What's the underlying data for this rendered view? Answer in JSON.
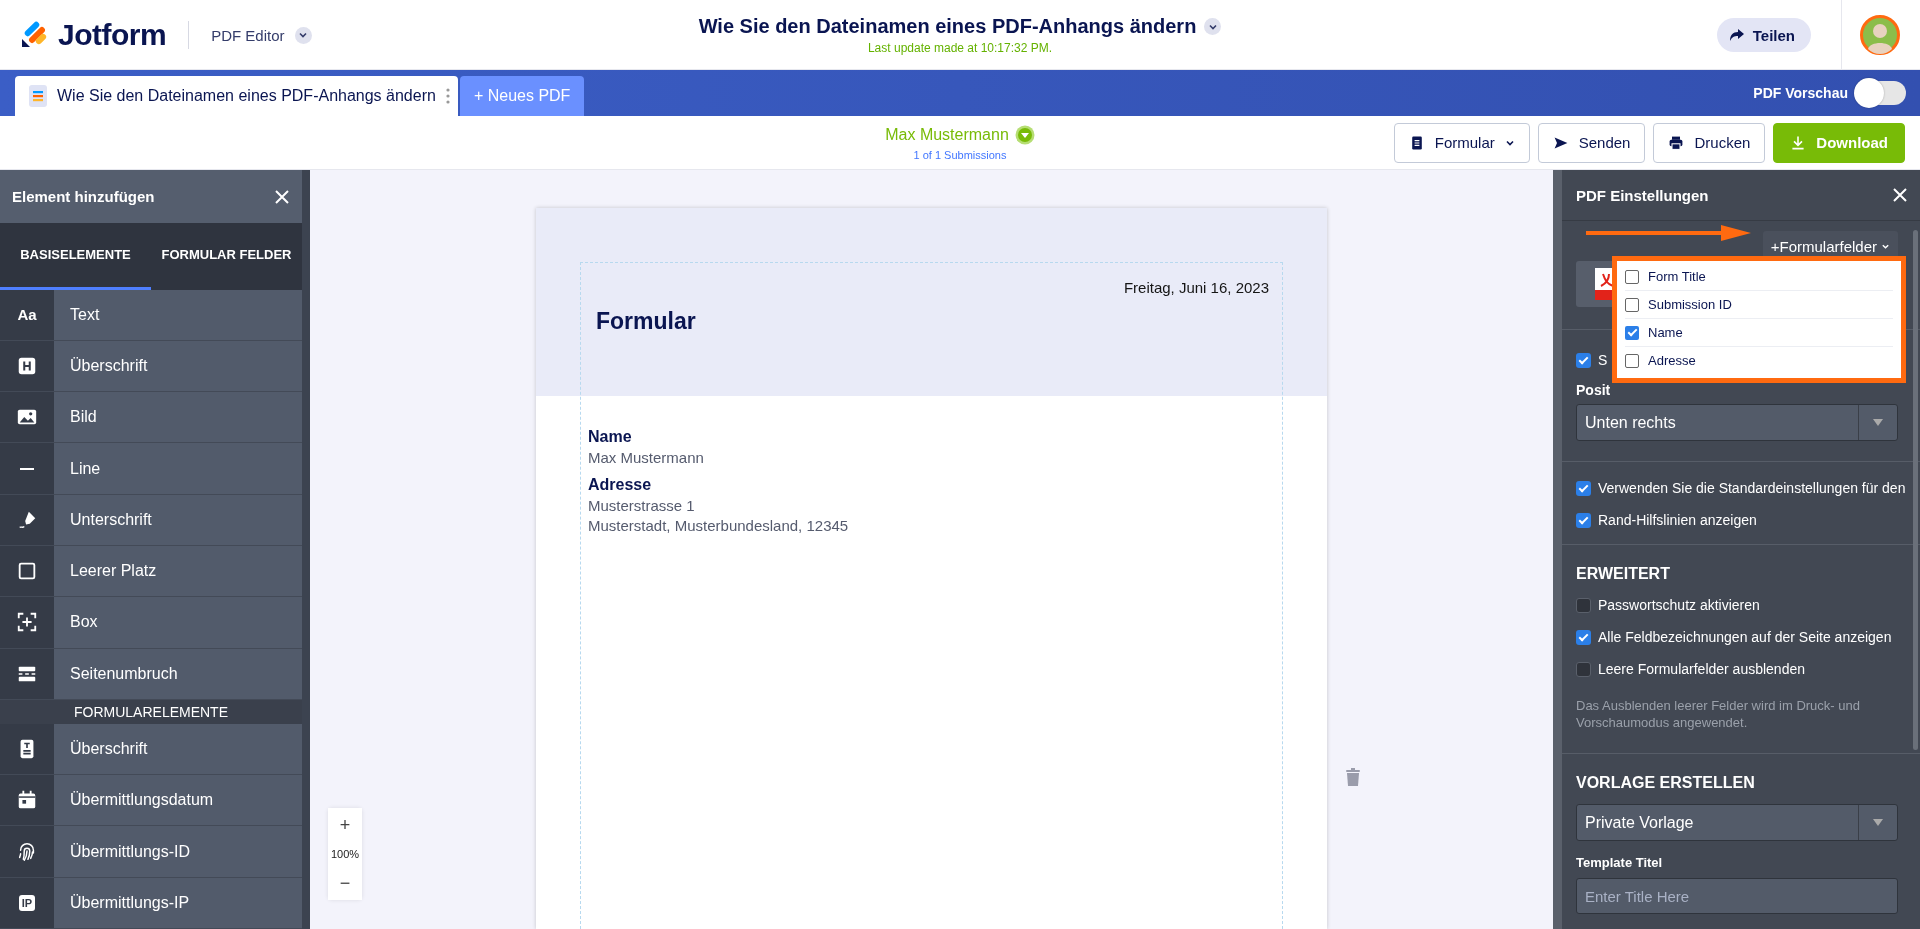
{
  "header": {
    "brand": "Jotform",
    "product": "PDF Editor",
    "title": "Wie Sie den Dateinamen eines PDF-Anhangs ändern",
    "last_update": "Last update made at 10:17:32 PM.",
    "share_button": "Teilen"
  },
  "tabs": [
    {
      "label": "Wie Sie den Dateinamen eines PDF-Anhangs ändern",
      "selected": true
    },
    {
      "label": "+ Neues PDF",
      "selected": false
    }
  ],
  "preview_toggle": {
    "label": "PDF Vorschau",
    "on": false
  },
  "submission": {
    "name": "Max Mustermann",
    "count": "1 of 1 Submissions"
  },
  "toolbar_buttons": [
    {
      "label": "Formular",
      "kind": "menu"
    },
    {
      "label": "Senden",
      "kind": "plain"
    },
    {
      "label": "Drucken",
      "kind": "plain"
    },
    {
      "label": "Download",
      "kind": "primary"
    }
  ],
  "left_panel": {
    "title": "Element hinzufügen",
    "tabs": [
      {
        "label": "BASISELEMENTE",
        "selected": true
      },
      {
        "label": "FORMULAR FELDER",
        "selected": false
      }
    ],
    "items": [
      {
        "kind": "item",
        "label": "Text",
        "icon_text": "Aa"
      },
      {
        "kind": "item",
        "label": "Überschrift"
      },
      {
        "kind": "item",
        "label": "Bild"
      },
      {
        "kind": "item",
        "label": "Line"
      },
      {
        "kind": "item",
        "label": "Unterschrift"
      },
      {
        "kind": "item",
        "label": "Leerer Platz"
      },
      {
        "kind": "item",
        "label": "Box"
      },
      {
        "kind": "item",
        "label": "Seitenumbruch"
      },
      {
        "kind": "heading",
        "label": "FORMULARELEMENTE"
      },
      {
        "kind": "item",
        "label": "Überschrift"
      },
      {
        "kind": "item",
        "label": "Übermittlungsdatum"
      },
      {
        "kind": "item",
        "label": "Übermittlungs-ID"
      },
      {
        "kind": "item",
        "label": "Übermittlungs-IP",
        "icon_text": "IP"
      }
    ]
  },
  "document": {
    "date": "Freitag, Juni 16, 2023",
    "title": "Formular",
    "fields": [
      {
        "label": "Name",
        "lines": [
          "Max Mustermann"
        ]
      },
      {
        "label": "Adresse",
        "lines": [
          "Musterstrasse 1",
          "Musterstadt, Musterbundesland, 12345"
        ]
      }
    ]
  },
  "zoom": {
    "zoom_in": "+",
    "zoom_text": "100%",
    "zoom_out": "−"
  },
  "right_panel": {
    "title": "PDF Einstellungen",
    "fields_button": "+Formularfelder",
    "fields_menu": [
      {
        "label": "Form Title",
        "checked": false
      },
      {
        "label": "Submission ID",
        "checked": false
      },
      {
        "label": "Name",
        "checked": true
      },
      {
        "label": "Adresse",
        "checked": false
      }
    ],
    "partial_option": {
      "label": "S",
      "checked": true
    },
    "position_label": "Posit",
    "position_select": "Unten rechts",
    "options": [
      {
        "label": "Verwenden Sie die Standardeinstellungen für den",
        "checked": true
      },
      {
        "label": "Rand-Hilfslinien anzeigen",
        "checked": true
      }
    ],
    "advanced": {
      "heading": "ERWEITERT",
      "options": [
        {
          "label": "Passwortschutz aktivieren",
          "checked": false
        },
        {
          "label": "Alle Feldbezeichnungen auf der Seite anzeigen",
          "checked": true
        },
        {
          "label": "Leere Formularfelder ausblenden",
          "checked": false
        }
      ],
      "hint": "Das Ausblenden leerer Felder wird im Druck- und Vorschaumodus angewendet."
    },
    "template": {
      "heading": "VORLAGE ERSTELLEN",
      "select": "Private Vorlage",
      "title_label": "Template Titel",
      "title_placeholder": "Enter Title Here"
    }
  }
}
